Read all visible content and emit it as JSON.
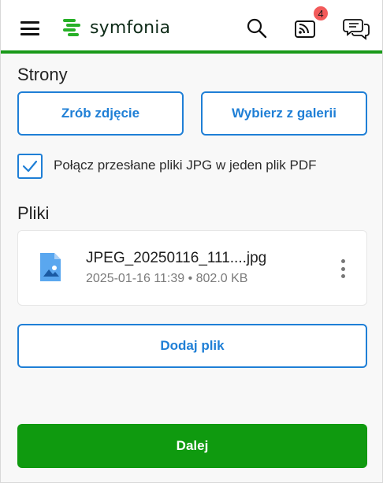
{
  "header": {
    "menu_icon": "hamburger-icon",
    "logo_text": "symfonia",
    "search_icon": "search-icon",
    "feed_icon": "feed-icon",
    "notifications_count": "4",
    "chat_icon": "chat-icon"
  },
  "pages_section": {
    "title": "Strony",
    "take_photo_label": "Zrób zdjęcie",
    "choose_gallery_label": "Wybierz z galerii",
    "merge_checkbox_checked": true,
    "merge_checkbox_label": "Połącz przesłane pliki JPG w jeden plik PDF"
  },
  "files_section": {
    "title": "Pliki",
    "files": [
      {
        "name": "JPEG_20250116_111....jpg",
        "meta": "2025-01-16 11:39 • 802.0 KB",
        "icon": "image-file-icon"
      }
    ],
    "add_file_label": "Dodaj plik"
  },
  "footer": {
    "next_label": "Dalej"
  },
  "colors": {
    "brand_green": "#0f9a0f",
    "accent_blue": "#1f7fd6",
    "badge_red": "#f25a5a"
  }
}
